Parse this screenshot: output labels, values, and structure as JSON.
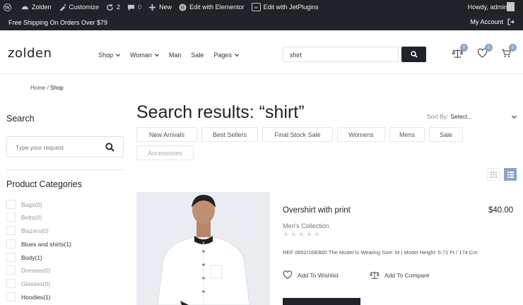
{
  "adminbar": {
    "site_name": "Zolden",
    "customize": "Customize",
    "updates_count": "2",
    "comments_count": "0",
    "new_label": "New",
    "elementor_label": "Edit with Elementor",
    "jet_label": "Edit with JetPlugins",
    "jet_badge": "JBK",
    "howdy": "Howdy, admin"
  },
  "topbar": {
    "promo": "Free Shipping On Orders Over $79",
    "account": "My Account"
  },
  "header": {
    "logo": "zolden",
    "nav": [
      {
        "label": "Shop",
        "has_dropdown": true
      },
      {
        "label": "Woman",
        "has_dropdown": true
      },
      {
        "label": "Man",
        "has_dropdown": false
      },
      {
        "label": "Sale",
        "has_dropdown": false
      },
      {
        "label": "Pages",
        "has_dropdown": true
      }
    ],
    "search_value": "shirt",
    "compare_count": "0",
    "wishlist_count": "0",
    "cart_count": "0"
  },
  "breadcrumb": {
    "home": "Home",
    "sep": "/",
    "current": "Shop"
  },
  "sidebar": {
    "search_title": "Search",
    "search_placeholder": "Type your request",
    "categories_title": "Product Categories",
    "categories": [
      {
        "label": "Bags",
        "count": "(0)",
        "muted": true
      },
      {
        "label": "Belts",
        "count": "(0)",
        "muted": true
      },
      {
        "label": "Blazers",
        "count": "(0)",
        "muted": true
      },
      {
        "label": "Blues and shirts",
        "count": "(1)",
        "muted": false
      },
      {
        "label": "Body",
        "count": "(1)",
        "muted": false
      },
      {
        "label": "Dresses",
        "count": "(0)",
        "muted": true
      },
      {
        "label": "Glasses",
        "count": "(0)",
        "muted": true
      },
      {
        "label": "Hoodies",
        "count": "(1)",
        "muted": false
      }
    ]
  },
  "main": {
    "title": "Search results: “shirt”",
    "sort_label": "Sort By:",
    "sort_value": "Select...",
    "filters": [
      "New Arrivals",
      "Best Sellers",
      "Final Stock Sale",
      "Womens",
      "Mens",
      "Sale",
      "Accessories"
    ]
  },
  "product": {
    "name": "Overshirt with print",
    "price": "$40.00",
    "collection": "Men's Collection",
    "rating": 0,
    "description": "REF 0652/168/800 The Model Is Wearing Size: M | Model Height: 5.71 Ft / 174 Cm",
    "wishlist": "Add To Wishlist",
    "compare": "Add To Compare"
  },
  "colors": {
    "dark": "#20232b",
    "accent": "#8aa4c8",
    "adminbar": "#1d2327"
  }
}
